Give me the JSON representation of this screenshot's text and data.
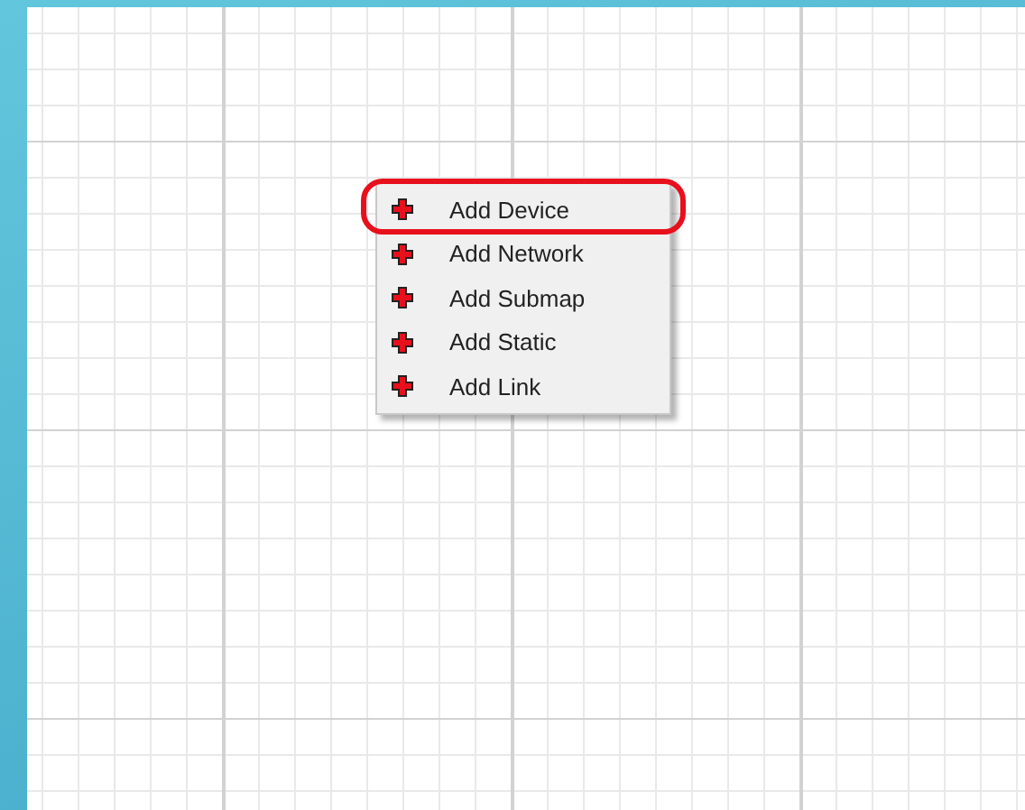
{
  "context_menu": {
    "items": [
      {
        "label": "Add Device",
        "circled": true
      },
      {
        "label": "Add Network",
        "circled": false
      },
      {
        "label": "Add Submap",
        "circled": false
      },
      {
        "label": "Add Static",
        "circled": false
      },
      {
        "label": "Add Link",
        "circled": false
      }
    ]
  }
}
